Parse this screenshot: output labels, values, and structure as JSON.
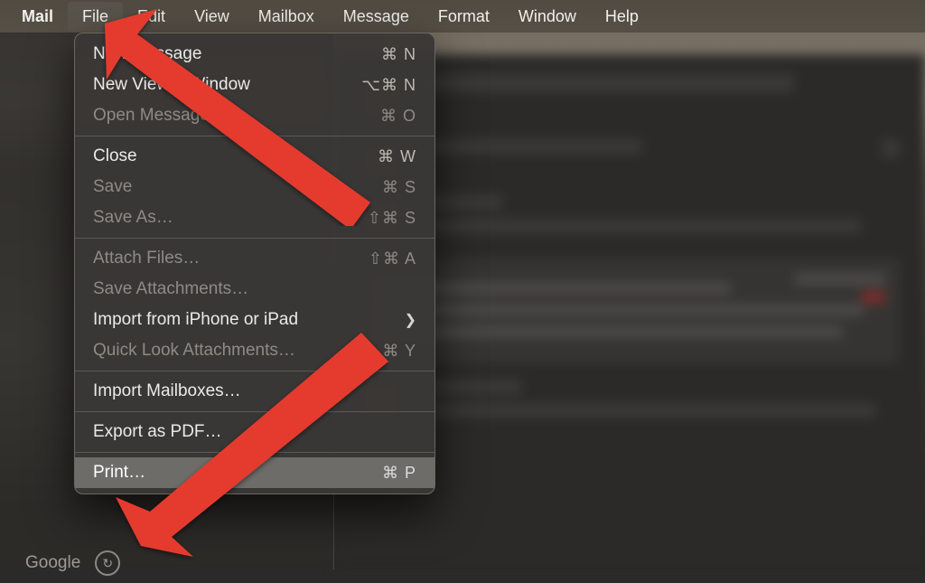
{
  "menubar": {
    "app": "Mail",
    "items": [
      "File",
      "Edit",
      "View",
      "Mailbox",
      "Message",
      "Format",
      "Window",
      "Help"
    ],
    "open_index": 0
  },
  "file_menu": {
    "groups": [
      [
        {
          "label": "New Message",
          "shortcut": "⌘ N",
          "enabled": true
        },
        {
          "label": "New Viewer Window",
          "shortcut": "⌥⌘ N",
          "enabled": true
        },
        {
          "label": "Open Messages",
          "shortcut": "⌘ O",
          "enabled": false
        }
      ],
      [
        {
          "label": "Close",
          "shortcut": "⌘ W",
          "enabled": true
        },
        {
          "label": "Save",
          "shortcut": "⌘ S",
          "enabled": false
        },
        {
          "label": "Save As…",
          "shortcut": "⇧⌘ S",
          "enabled": false
        }
      ],
      [
        {
          "label": "Attach Files…",
          "shortcut": "⇧⌘ A",
          "enabled": false
        },
        {
          "label": "Save Attachments…",
          "shortcut": "",
          "enabled": false
        },
        {
          "label": "Import from iPhone or iPad",
          "shortcut": "",
          "enabled": true,
          "submenu": true
        },
        {
          "label": "Quick Look Attachments…",
          "shortcut": "⌘ Y",
          "enabled": false
        }
      ],
      [
        {
          "label": "Import Mailboxes…",
          "shortcut": "",
          "enabled": true
        }
      ],
      [
        {
          "label": "Export as PDF…",
          "shortcut": "",
          "enabled": true
        }
      ],
      [
        {
          "label": "Print…",
          "shortcut": "⌘ P",
          "enabled": true,
          "highlight": true
        }
      ]
    ]
  },
  "sidebar": {
    "account_label": "Google"
  }
}
